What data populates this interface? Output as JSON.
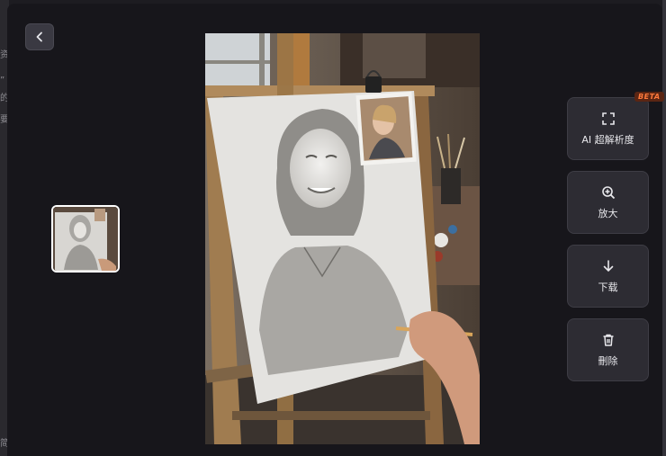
{
  "backdrop": {
    "fragments": [
      "资",
      "”",
      "的",
      "要",
      "简"
    ]
  },
  "viewer": {
    "back_icon": "chevron-left-icon",
    "thumbnail_alt": "Pencil sketch portrait thumbnail",
    "main_image_alt": "Hand drawing a pencil portrait of a smiling woman on an easel"
  },
  "actions": [
    {
      "id": "upscale",
      "label": "AI 超解析度",
      "icon": "expand-icon",
      "badge": "BETA"
    },
    {
      "id": "zoom",
      "label": "放大",
      "icon": "zoom-in-icon"
    },
    {
      "id": "download",
      "label": "下载",
      "icon": "download-icon"
    },
    {
      "id": "delete",
      "label": "刪除",
      "icon": "trash-icon"
    }
  ],
  "colors": {
    "background": "#17161b",
    "button": "#2d2c33",
    "beta_bg": "#5a2513",
    "beta_text": "#ff7a3c"
  }
}
